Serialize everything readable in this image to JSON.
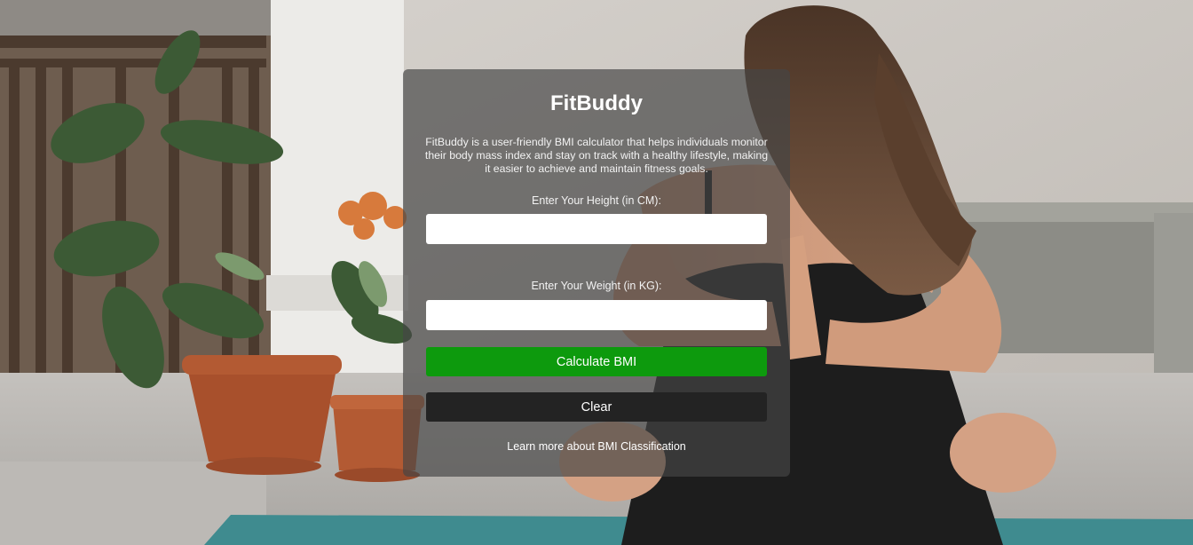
{
  "app": {
    "title": "FitBuddy",
    "description": "FitBuddy is a user-friendly BMI calculator that helps individuals monitor their body mass index and stay on track with a healthy lifestyle, making it easier to achieve and maintain fitness goals."
  },
  "form": {
    "height_label": "Enter Your Height (in CM):",
    "height_value": "",
    "height_placeholder": "",
    "weight_label": "Enter Your Weight (in KG):",
    "weight_value": "",
    "weight_placeholder": "",
    "calculate_label": "Calculate BMI",
    "clear_label": "Clear",
    "learn_more_label": "Learn more about BMI Classification"
  },
  "colors": {
    "calculate_button": "#0d9a0d",
    "clear_button": "#232323",
    "panel_overlay": "#464646"
  }
}
